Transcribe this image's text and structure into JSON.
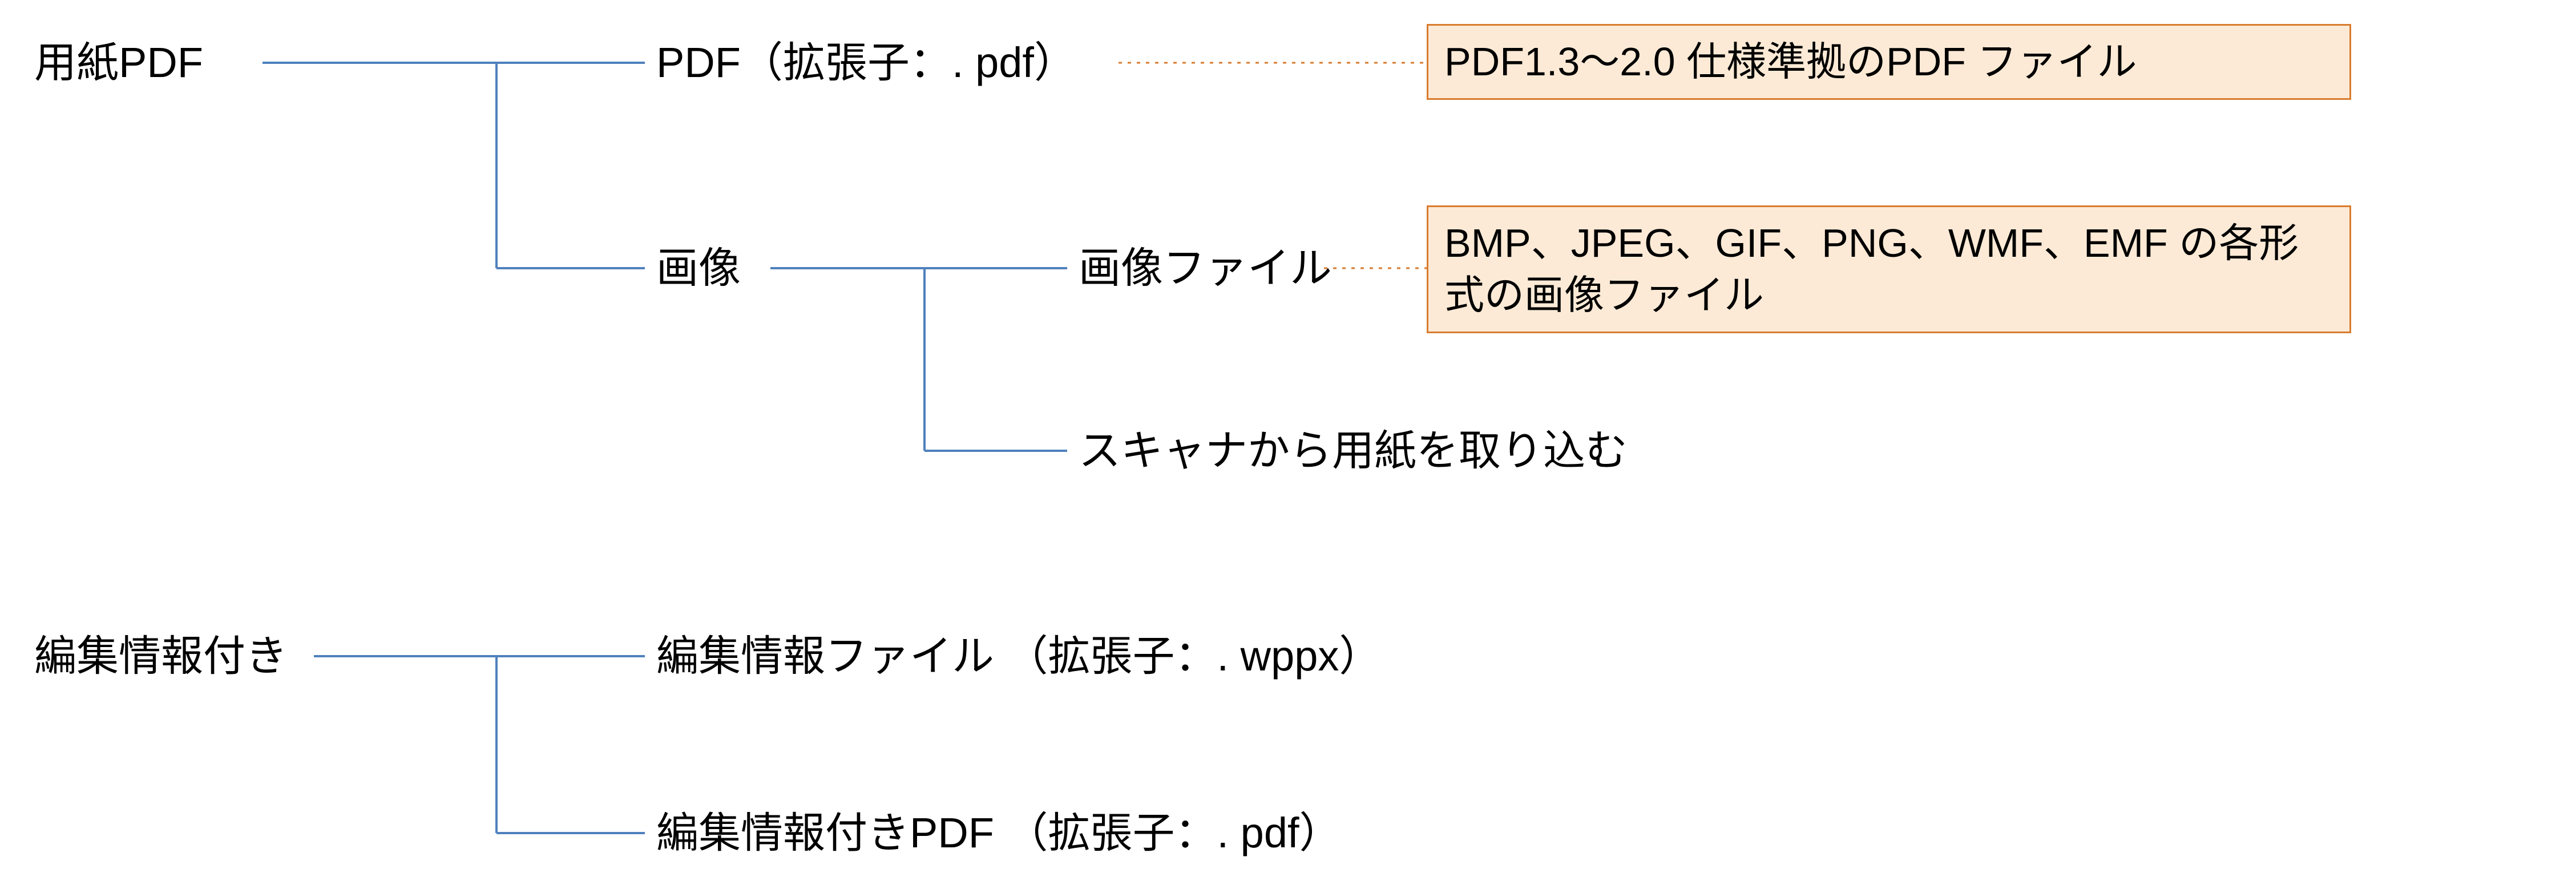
{
  "tree": {
    "root1": {
      "label": "用紙PDF"
    },
    "root2": {
      "label": "編集情報付き"
    },
    "r1_c1": {
      "label": "PDF（拡張子：. pdf）"
    },
    "r1_c2": {
      "label": "画像"
    },
    "r1_c2_c1": {
      "label": "画像ファイル"
    },
    "r1_c2_c2": {
      "label": "スキャナから用紙を取り込む"
    },
    "r2_c1": {
      "label": "編集情報ファイル （拡張子：. wppx）"
    },
    "r2_c2": {
      "label": "編集情報付きPDF （拡張子：. pdf）"
    }
  },
  "callouts": {
    "pdf_spec": "PDF1.3～2.0 仕様準拠のPDF ファイル",
    "image_formats": "BMP、JPEG、GIF、PNG、WMF、EMF の各形式の画像ファイル"
  },
  "colors": {
    "connector": "#4F81BD",
    "dotted": "#D97B2E",
    "callout_bg": "#FCEAD6",
    "callout_border": "#D97B2E"
  }
}
